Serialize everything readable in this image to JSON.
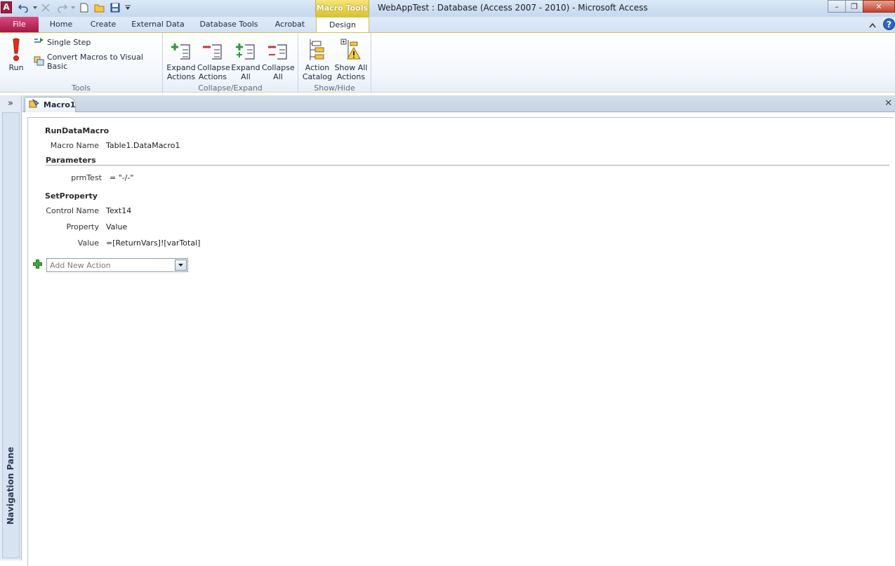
{
  "titlebar": {
    "app_icon_letter": "A",
    "contextual_tab": "Macro Tools",
    "window_title": "WebAppTest : Database (Access 2007 - 2010)  -  Microsoft Access",
    "minimize": "–",
    "restore": "❐",
    "close": "✕"
  },
  "tabs": {
    "file": "File",
    "home": "Home",
    "create": "Create",
    "external": "External Data",
    "dbtools": "Database Tools",
    "acrobat": "Acrobat",
    "design": "Design"
  },
  "ribbon": {
    "tools": {
      "run": "Run",
      "single_step": "Single Step",
      "convert": "Convert Macros to Visual Basic",
      "label": "Tools"
    },
    "collapse_expand": {
      "expand_actions_1": "Expand",
      "expand_actions_2": "Actions",
      "collapse_actions_1": "Collapse",
      "collapse_actions_2": "Actions",
      "expand_all_1": "Expand",
      "expand_all_2": "All",
      "collapse_all_1": "Collapse",
      "collapse_all_2": "All",
      "label": "Collapse/Expand"
    },
    "show_hide": {
      "action_catalog_1": "Action",
      "action_catalog_2": "Catalog",
      "show_all_1": "Show All",
      "show_all_2": "Actions",
      "label": "Show/Hide"
    }
  },
  "nav": {
    "toggle": "»",
    "label": "Navigation Pane"
  },
  "document": {
    "tab": "Macro1",
    "close": "✕"
  },
  "macro": {
    "run_data_macro": {
      "title": "RunDataMacro",
      "macro_name_label": "Macro Name",
      "macro_name_value": "Table1.DataMacro1",
      "parameters_label": "Parameters",
      "param_name": "prmTest",
      "param_value": "= \"-/-\""
    },
    "set_property": {
      "title": "SetProperty",
      "control_name_label": "Control Name",
      "control_name_value": "Text14",
      "property_label": "Property",
      "property_value": "Value",
      "value_label": "Value",
      "value_value": "=[ReturnVars]![varTotal]"
    },
    "add_new_action_placeholder": "Add New Action"
  },
  "colors": {
    "file_tab": "#a8184a",
    "contextual": "#e7cf44",
    "ribbon_bg": "#f3f7fc"
  }
}
